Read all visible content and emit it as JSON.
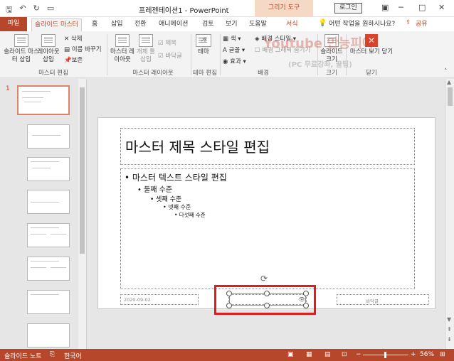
{
  "window": {
    "title": "프레젠테이션1 - PowerPoint",
    "context_tool": "그리기 도구",
    "login_label": "로그인",
    "minimize": "─",
    "restore": "□",
    "close": "✕"
  },
  "qat": {
    "save_icon": "save-icon",
    "undo_icon": "undo-icon",
    "redo_icon": "redo-icon",
    "present_icon": "present-icon"
  },
  "tabs": {
    "file": "파일",
    "slide_master": "슬라이드 마스터",
    "home": "홈",
    "insert": "삽입",
    "transitions": "전환",
    "animations": "애니메이션",
    "review": "검토",
    "view": "보기",
    "help": "도움말",
    "format": "서식",
    "tell_me": "어떤 작업을 원하시나요?",
    "share": "공유"
  },
  "ribbon": {
    "insert_slide_master": "슬라이드 마스터 삽입",
    "insert_layout": "레이아웃 삽입",
    "delete": "삭제",
    "rename": "이름 바꾸기",
    "preserve": "보존",
    "group_edit_master": "마스터 편집",
    "master_layout": "마스터 레이아웃",
    "insert_placeholder": "개체 틀 삽입",
    "title_check": "제목",
    "footer_check": "바닥글",
    "group_master_layout": "마스터 레이아웃",
    "themes": "테마",
    "group_edit_theme": "테마 편집",
    "colors": "색",
    "fonts": "글꼴",
    "effects": "효과",
    "background_styles": "배경 스타일",
    "hide_bg_graphics": "배경 그래픽 숨기기",
    "group_background": "배경",
    "slide_size": "슬라이드 크기",
    "group_size": "크기",
    "close_master_view": "마스터 보기 닫기",
    "group_close": "닫기"
  },
  "watermark": {
    "line1": "Youtube 만능피아",
    "line2": "(PC 무료강좌, 꿀팁)"
  },
  "thumbnail": {
    "number": "1"
  },
  "slide": {
    "title": "마스터 제목 스타일 편집",
    "bullet1": "• 마스터 텍스트 스타일 편집",
    "bullet2": "• 둘째 수준",
    "bullet3": "• 셋째 수준",
    "bullet4": "• 넷째 수준",
    "bullet5": "• 다섯째 수준",
    "date": "2020-09-02",
    "footer": "바닥글"
  },
  "status": {
    "slide_notes": "슬라이드 노트",
    "language": "한국어",
    "zoom": "56%"
  },
  "colors": {
    "accent": "#b7472a",
    "highlight": "#e01c1c"
  }
}
